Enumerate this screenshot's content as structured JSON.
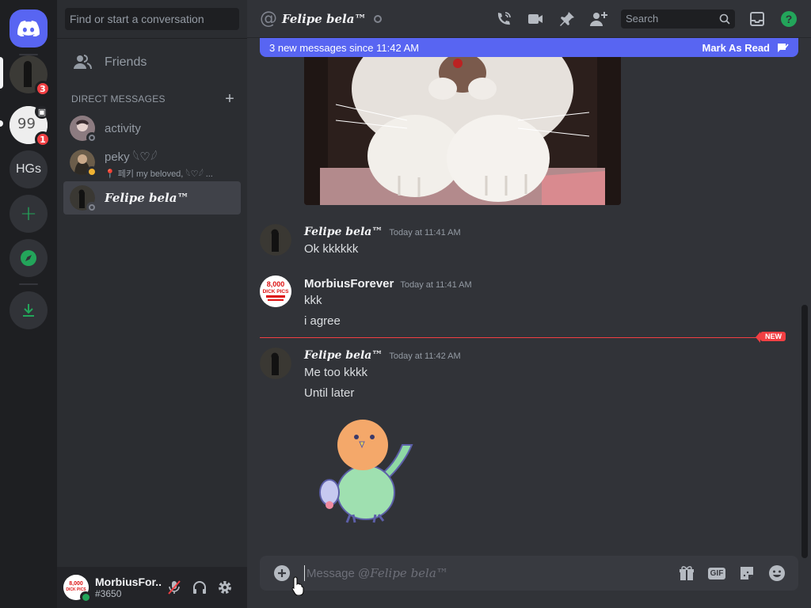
{
  "rail": {
    "server_badge_1": "3",
    "server_badge_2": "1",
    "server_hgs": "HGs"
  },
  "sidebar": {
    "search_placeholder": "Find or start a conversation",
    "friends_label": "Friends",
    "dm_header": "DIRECT MESSAGES",
    "dms": [
      {
        "name": "activity"
      },
      {
        "name": "peky 𓆩♡𓆪",
        "sub": "📍 페키 my beloved, 𓆩♡𓆪 ..."
      },
      {
        "name": "Felipe bela™"
      }
    ]
  },
  "user_panel": {
    "name": "MorbiusFor...",
    "tag": "#3650"
  },
  "topbar": {
    "channel_name": "Felipe bela™",
    "search_placeholder": "Search"
  },
  "new_messages_bar": {
    "text": "3 new messages since 11:42 AM",
    "mark_read": "Mark As Read"
  },
  "messages": [
    {
      "author": "Felipe bela™",
      "timestamp": "Today at 11:41 AM",
      "lines": [
        "Ok kkkkkk"
      ]
    },
    {
      "author": "MorbiusForever",
      "timestamp": "Today at 11:41 AM",
      "lines": [
        "kkk",
        "i agree"
      ]
    },
    {
      "author": "Felipe bela™",
      "timestamp": "Today at 11:42 AM",
      "lines": [
        "Me too kkkk",
        "Until later"
      ]
    }
  ],
  "new_divider_label": "NEW",
  "composer": {
    "placeholder_prefix": "Message @",
    "placeholder_name": "Felipe bela™",
    "gif_label": "GIF"
  },
  "avatar_text": {
    "line1": "8,000",
    "line2": "DICK PICS"
  },
  "colors": {
    "blurple": "#5865f2",
    "red": "#f23f43",
    "green": "#23a55a"
  }
}
